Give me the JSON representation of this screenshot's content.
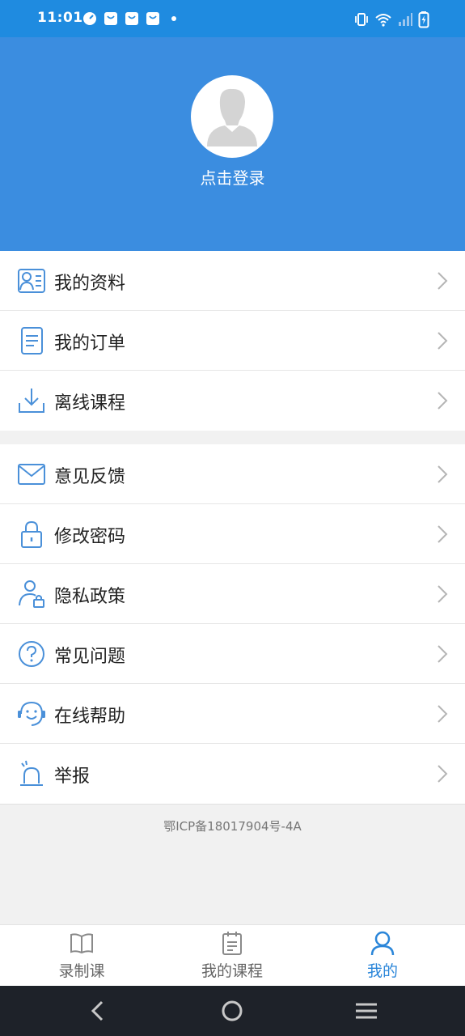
{
  "status_bar": {
    "time": "11:01",
    "left_icons": [
      "speedometer-icon",
      "bag-icon",
      "bag-icon",
      "bag-icon",
      "dot-icon"
    ],
    "right_icons": [
      "vibrate-icon",
      "wifi-icon",
      "signal-icon",
      "battery-charging-icon"
    ]
  },
  "header": {
    "avatar_icon": "default-avatar-icon",
    "login_label": "点击登录"
  },
  "menu_group_1": [
    {
      "icon": "profile-card-icon",
      "label": "我的资料"
    },
    {
      "icon": "order-document-icon",
      "label": "我的订单"
    },
    {
      "icon": "download-icon",
      "label": "离线课程"
    }
  ],
  "menu_group_2": [
    {
      "icon": "envelope-icon",
      "label": "意见反馈"
    },
    {
      "icon": "lock-icon",
      "label": "修改密码"
    },
    {
      "icon": "user-lock-icon",
      "label": "隐私政策"
    },
    {
      "icon": "question-icon",
      "label": "常见问题"
    },
    {
      "icon": "headset-smile-icon",
      "label": "在线帮助"
    },
    {
      "icon": "alarm-light-icon",
      "label": "举报"
    }
  ],
  "footer": {
    "icp": "鄂ICP备18017904号-4A"
  },
  "tabs": [
    {
      "icon": "book-icon",
      "label": "录制课",
      "active": false
    },
    {
      "icon": "clipboard-icon",
      "label": "我的课程",
      "active": false
    },
    {
      "icon": "person-icon",
      "label": "我的",
      "active": true
    }
  ],
  "colors": {
    "status_bar": "#1f8be0",
    "header": "#3b8de0",
    "accent": "#2b86d9",
    "icon_blue": "#4a90d9"
  }
}
